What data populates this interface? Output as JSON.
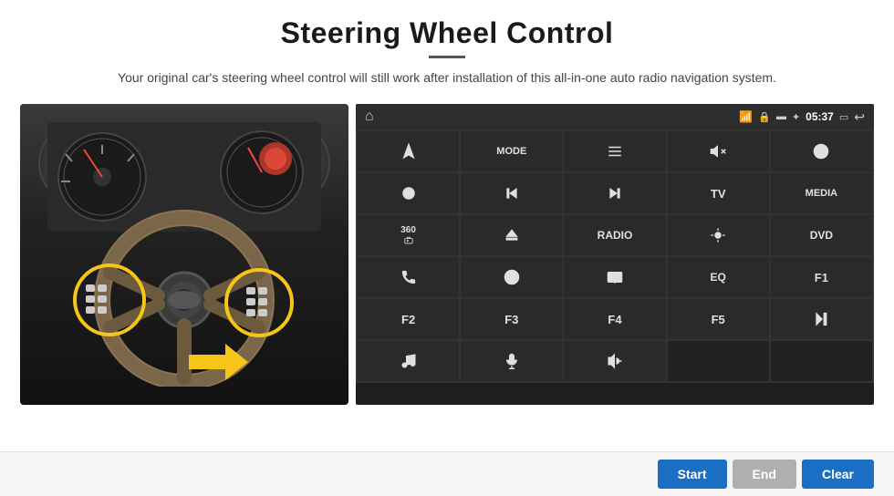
{
  "header": {
    "title": "Steering Wheel Control",
    "subtitle": "Your original car's steering wheel control will still work after installation of this all-in-one auto radio navigation system."
  },
  "status_bar": {
    "time": "05:37",
    "icons": [
      "wifi",
      "lock",
      "sd-card",
      "bluetooth",
      "battery",
      "back"
    ]
  },
  "button_grid": [
    [
      {
        "label": "▲",
        "icon": "navigate-icon",
        "type": "icon"
      },
      {
        "label": "MODE",
        "type": "text"
      },
      {
        "label": "≡",
        "icon": "list-icon",
        "type": "icon"
      },
      {
        "label": "🔇",
        "icon": "mute-icon",
        "type": "icon"
      },
      {
        "label": "⊞",
        "icon": "grid-icon",
        "type": "icon"
      }
    ],
    [
      {
        "label": "⊙",
        "icon": "settings-icon",
        "type": "icon"
      },
      {
        "label": "⏮",
        "icon": "prev-icon",
        "type": "icon"
      },
      {
        "label": "⏭",
        "icon": "next-icon",
        "type": "icon"
      },
      {
        "label": "TV",
        "type": "text"
      },
      {
        "label": "MEDIA",
        "type": "text"
      }
    ],
    [
      {
        "label": "360",
        "icon": "camera-icon",
        "type": "text-sm"
      },
      {
        "label": "▲",
        "icon": "eject-icon",
        "type": "icon"
      },
      {
        "label": "RADIO",
        "type": "text"
      },
      {
        "label": "☀",
        "icon": "brightness-icon",
        "type": "icon"
      },
      {
        "label": "DVD",
        "type": "text"
      }
    ],
    [
      {
        "label": "📞",
        "icon": "phone-icon",
        "type": "icon"
      },
      {
        "label": "🌀",
        "icon": "nav-icon",
        "type": "icon"
      },
      {
        "label": "⬛",
        "icon": "screen-icon",
        "type": "icon"
      },
      {
        "label": "EQ",
        "type": "text"
      },
      {
        "label": "F1",
        "type": "text"
      }
    ],
    [
      {
        "label": "F2",
        "type": "text"
      },
      {
        "label": "F3",
        "type": "text"
      },
      {
        "label": "F4",
        "type": "text"
      },
      {
        "label": "F5",
        "type": "text"
      },
      {
        "label": "▶⏸",
        "icon": "playpause-icon",
        "type": "icon"
      }
    ],
    [
      {
        "label": "♪",
        "icon": "music-icon",
        "type": "icon"
      },
      {
        "label": "🎤",
        "icon": "mic-icon",
        "type": "icon"
      },
      {
        "label": "🔊/📞",
        "icon": "vol-phone-icon",
        "type": "icon"
      },
      {
        "label": "",
        "type": "empty"
      },
      {
        "label": "",
        "type": "empty"
      }
    ]
  ],
  "bottom_buttons": {
    "start_label": "Start",
    "end_label": "End",
    "clear_label": "Clear"
  }
}
